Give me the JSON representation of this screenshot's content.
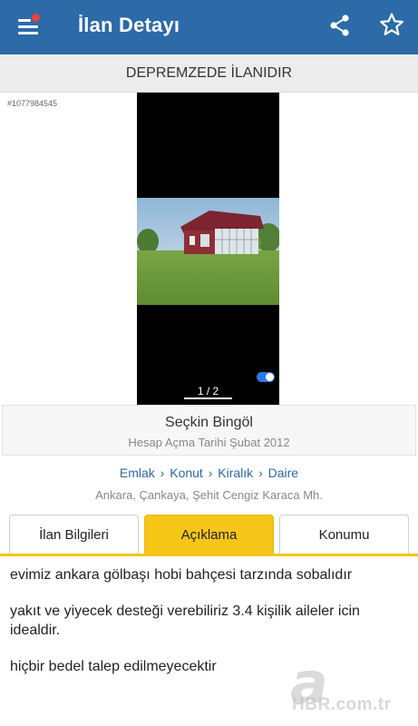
{
  "appbar": {
    "title": "İlan Detayı",
    "icons": [
      "menu-icon",
      "share-icon",
      "star-icon"
    ],
    "color": "#2c6aa8",
    "notification_dot_color": "#e8453c"
  },
  "banner": {
    "text": "DEPREMZEDE İLANIDIR"
  },
  "listing": {
    "id": "#1077984545"
  },
  "photo": {
    "counter": "1 / 2",
    "toggle_on": true
  },
  "seller": {
    "name": "Seçkin Bingöl",
    "account_date": "Hesap Açma Tarihi  Şubat 2012"
  },
  "breadcrumb": {
    "items": [
      "Emlak",
      "Konut",
      "Kiralık",
      "Daire"
    ],
    "separator": "›"
  },
  "location": "Ankara, Çankaya, Şehit Cengiz Karaca Mh.",
  "tabs": [
    {
      "label": "İlan Bilgileri",
      "active": false
    },
    {
      "label": "Açıklama",
      "active": true
    },
    {
      "label": "Konumu",
      "active": false
    }
  ],
  "accent_color": "#f5c518",
  "description": [
    "evimiz ankara gölbaşı hobi bahçesi tarzında sobalıdır",
    "yakıt ve yiyecek desteği verebiliriz 3.4 kişilik aileler icin idealdir.",
    "hiçbir bedel talep edilmeyecektir"
  ],
  "watermark": {
    "logo": "a",
    "text": "HBR.com.tr"
  }
}
